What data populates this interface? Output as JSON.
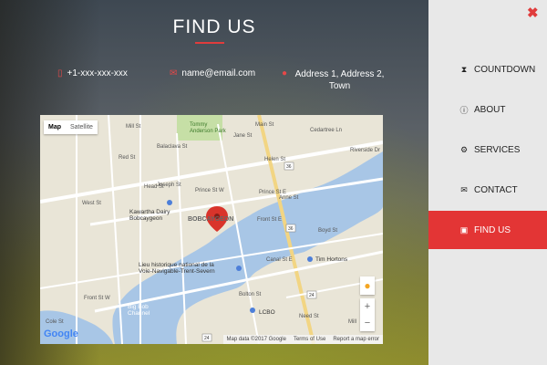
{
  "header": {
    "title": "FIND US"
  },
  "contacts": {
    "phone": "+1-xxx-xxx-xxx",
    "email": "name@email.com",
    "address": "Address 1, Address 2, Town"
  },
  "map": {
    "type_buttons": {
      "map": "Map",
      "satellite": "Satellite"
    },
    "labels": {
      "park": "Tommy\nAnderson Park",
      "town": "BOBCAYGEON",
      "dairy": "Kawartha Dairy\nBobcaygeon",
      "lieu": "Lieu historique national de la\nVoie-Navigable-Trent-Severn",
      "tim": "Tim Hortons",
      "lcbo": "LCBO",
      "channel": "Big Bob\nChannel",
      "jane": "Jane St",
      "joseph": "Joseph St",
      "prince_w": "Prince St W",
      "prince_e": "Prince St E",
      "front_e": "Front St E",
      "front_w": "Front St W",
      "boyd": "Boyd St",
      "canal": "Canal St E",
      "cedartree": "Cedartree Ln",
      "riverside": "Riverside Dr",
      "helen": "Helen St",
      "anne": "Anne St",
      "head": "Head St",
      "red": "Red St",
      "west": "West St",
      "balaclava": "Balaclava St",
      "mill": "Mill St",
      "main": "Main St",
      "bolton": "Bolton St",
      "need": "Need St",
      "cole": "Cole St",
      "mill2": "Mill",
      "shield36a": "36",
      "shield36b": "36",
      "shield24a": "24",
      "shield24b": "24"
    },
    "zoom_in": "+",
    "zoom_out": "−",
    "google_logo": "Google",
    "attribution": {
      "data": "Map data ©2017 Google",
      "terms": "Terms of Use",
      "report": "Report a map error"
    }
  },
  "sidebar": {
    "items": [
      {
        "label": "COUNTDOWN",
        "icon": "hourglass-icon"
      },
      {
        "label": "ABOUT",
        "icon": "info-icon"
      },
      {
        "label": "SERVICES",
        "icon": "gears-icon"
      },
      {
        "label": "CONTACT",
        "icon": "envelope-icon"
      },
      {
        "label": "FIND US",
        "icon": "map-icon"
      }
    ],
    "active_index": 4
  },
  "colors": {
    "accent": "#e33535",
    "panel_bg": "#e8e8e8"
  }
}
